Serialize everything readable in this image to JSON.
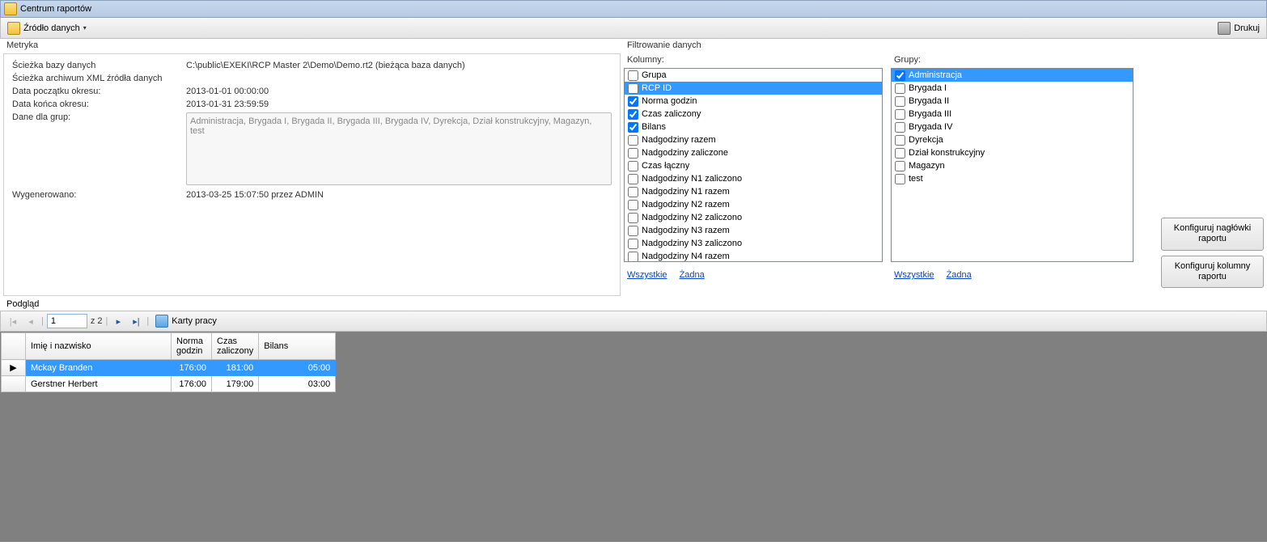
{
  "window": {
    "title": "Centrum raportów"
  },
  "toolbar": {
    "datasource_label": "Źródło danych",
    "print_label": "Drukuj"
  },
  "metryka": {
    "section_label": "Metryka",
    "rows": {
      "db_path_label": "Ścieżka bazy danych",
      "db_path_value": "C:\\public\\EXEKI\\RCP Master 2\\Demo\\Demo.rt2 (bieżąca baza danych)",
      "xml_path_label": "Ścieżka archiwum XML źródła danych",
      "xml_path_value": "",
      "start_label": "Data początku okresu:",
      "start_value": "2013-01-01 00:00:00",
      "end_label": "Data końca okresu:",
      "end_value": "2013-01-31 23:59:59",
      "groups_label": "Dane dla grup:",
      "groups_value": "Administracja, Brygada I, Brygada II, Brygada III, Brygada IV, Dyrekcja, Dział konstrukcyjny, Magazyn, test",
      "gen_label": "Wygenerowano:",
      "gen_value": "2013-03-25 15:07:50 przez ADMIN"
    }
  },
  "filter": {
    "section_label": "Filtrowanie danych",
    "kolumny_label": "Kolumny:",
    "grupy_label": "Grupy:",
    "link_all": "Wszystkie",
    "link_none": "Żadna",
    "kolumny": [
      {
        "label": "Grupa",
        "checked": false,
        "selected": false
      },
      {
        "label": "RCP ID",
        "checked": false,
        "selected": true
      },
      {
        "label": "Norma godzin",
        "checked": true,
        "selected": false
      },
      {
        "label": "Czas zaliczony",
        "checked": true,
        "selected": false
      },
      {
        "label": "Bilans",
        "checked": true,
        "selected": false
      },
      {
        "label": "Nadgodziny razem",
        "checked": false,
        "selected": false
      },
      {
        "label": "Nadgodziny zaliczone",
        "checked": false,
        "selected": false
      },
      {
        "label": "Czas łączny",
        "checked": false,
        "selected": false
      },
      {
        "label": "Nadgodziny N1 zaliczono",
        "checked": false,
        "selected": false
      },
      {
        "label": "Nadgodziny N1 razem",
        "checked": false,
        "selected": false
      },
      {
        "label": "Nadgodziny N2 razem",
        "checked": false,
        "selected": false
      },
      {
        "label": "Nadgodziny N2 zaliczono",
        "checked": false,
        "selected": false
      },
      {
        "label": "Nadgodziny N3 razem",
        "checked": false,
        "selected": false
      },
      {
        "label": "Nadgodziny N3 zaliczono",
        "checked": false,
        "selected": false
      },
      {
        "label": "Nadgodziny N4 razem",
        "checked": false,
        "selected": false
      }
    ],
    "grupy": [
      {
        "label": "Administracja",
        "checked": true,
        "selected": true
      },
      {
        "label": "Brygada I",
        "checked": false,
        "selected": false
      },
      {
        "label": "Brygada II",
        "checked": false,
        "selected": false
      },
      {
        "label": "Brygada III",
        "checked": false,
        "selected": false
      },
      {
        "label": "Brygada IV",
        "checked": false,
        "selected": false
      },
      {
        "label": "Dyrekcja",
        "checked": false,
        "selected": false
      },
      {
        "label": "Dział konstrukcyjny",
        "checked": false,
        "selected": false
      },
      {
        "label": "Magazyn",
        "checked": false,
        "selected": false
      },
      {
        "label": "test",
        "checked": false,
        "selected": false
      }
    ]
  },
  "side_buttons": {
    "headers": "Konfiguruj nagłówki raportu",
    "columns": "Konfiguruj kolumny raportu"
  },
  "preview": {
    "label": "Podgląd",
    "page_current": "1",
    "page_of": "z 2",
    "karty_label": "Karty pracy",
    "columns": [
      "",
      "Imię i nazwisko",
      "Norma godzin",
      "Czas zaliczony",
      "Bilans"
    ],
    "rows": [
      {
        "indicator": "▶",
        "name": "Mckay Branden",
        "norma": "176:00",
        "czas": "181:00",
        "bilans": "05:00",
        "selected": true
      },
      {
        "indicator": "",
        "name": "Gerstner Herbert",
        "norma": "176:00",
        "czas": "179:00",
        "bilans": "03:00",
        "selected": false
      }
    ]
  }
}
